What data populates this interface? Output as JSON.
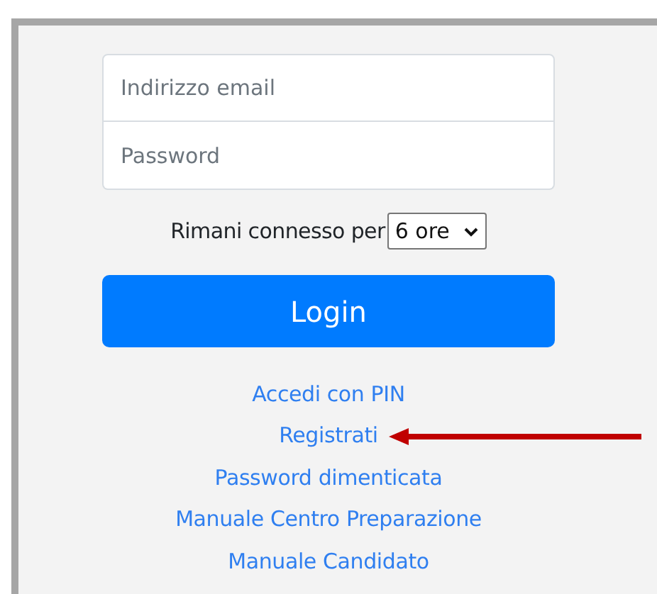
{
  "fields": [
    {
      "placeholder": "Indirizzo email"
    },
    {
      "placeholder": "Password"
    }
  ],
  "stay_connected": {
    "label": "Rimani connesso per",
    "value": "6 ore"
  },
  "login_button": "Login",
  "links": [
    {
      "label": "Accedi con PIN",
      "highlighted": false
    },
    {
      "label": "Registrati",
      "highlighted": true
    },
    {
      "label": "Password dimenticata",
      "highlighted": false
    },
    {
      "label": "Manuale Centro Preparazione",
      "highlighted": false
    },
    {
      "label": "Manuale Candidato",
      "highlighted": false
    }
  ]
}
